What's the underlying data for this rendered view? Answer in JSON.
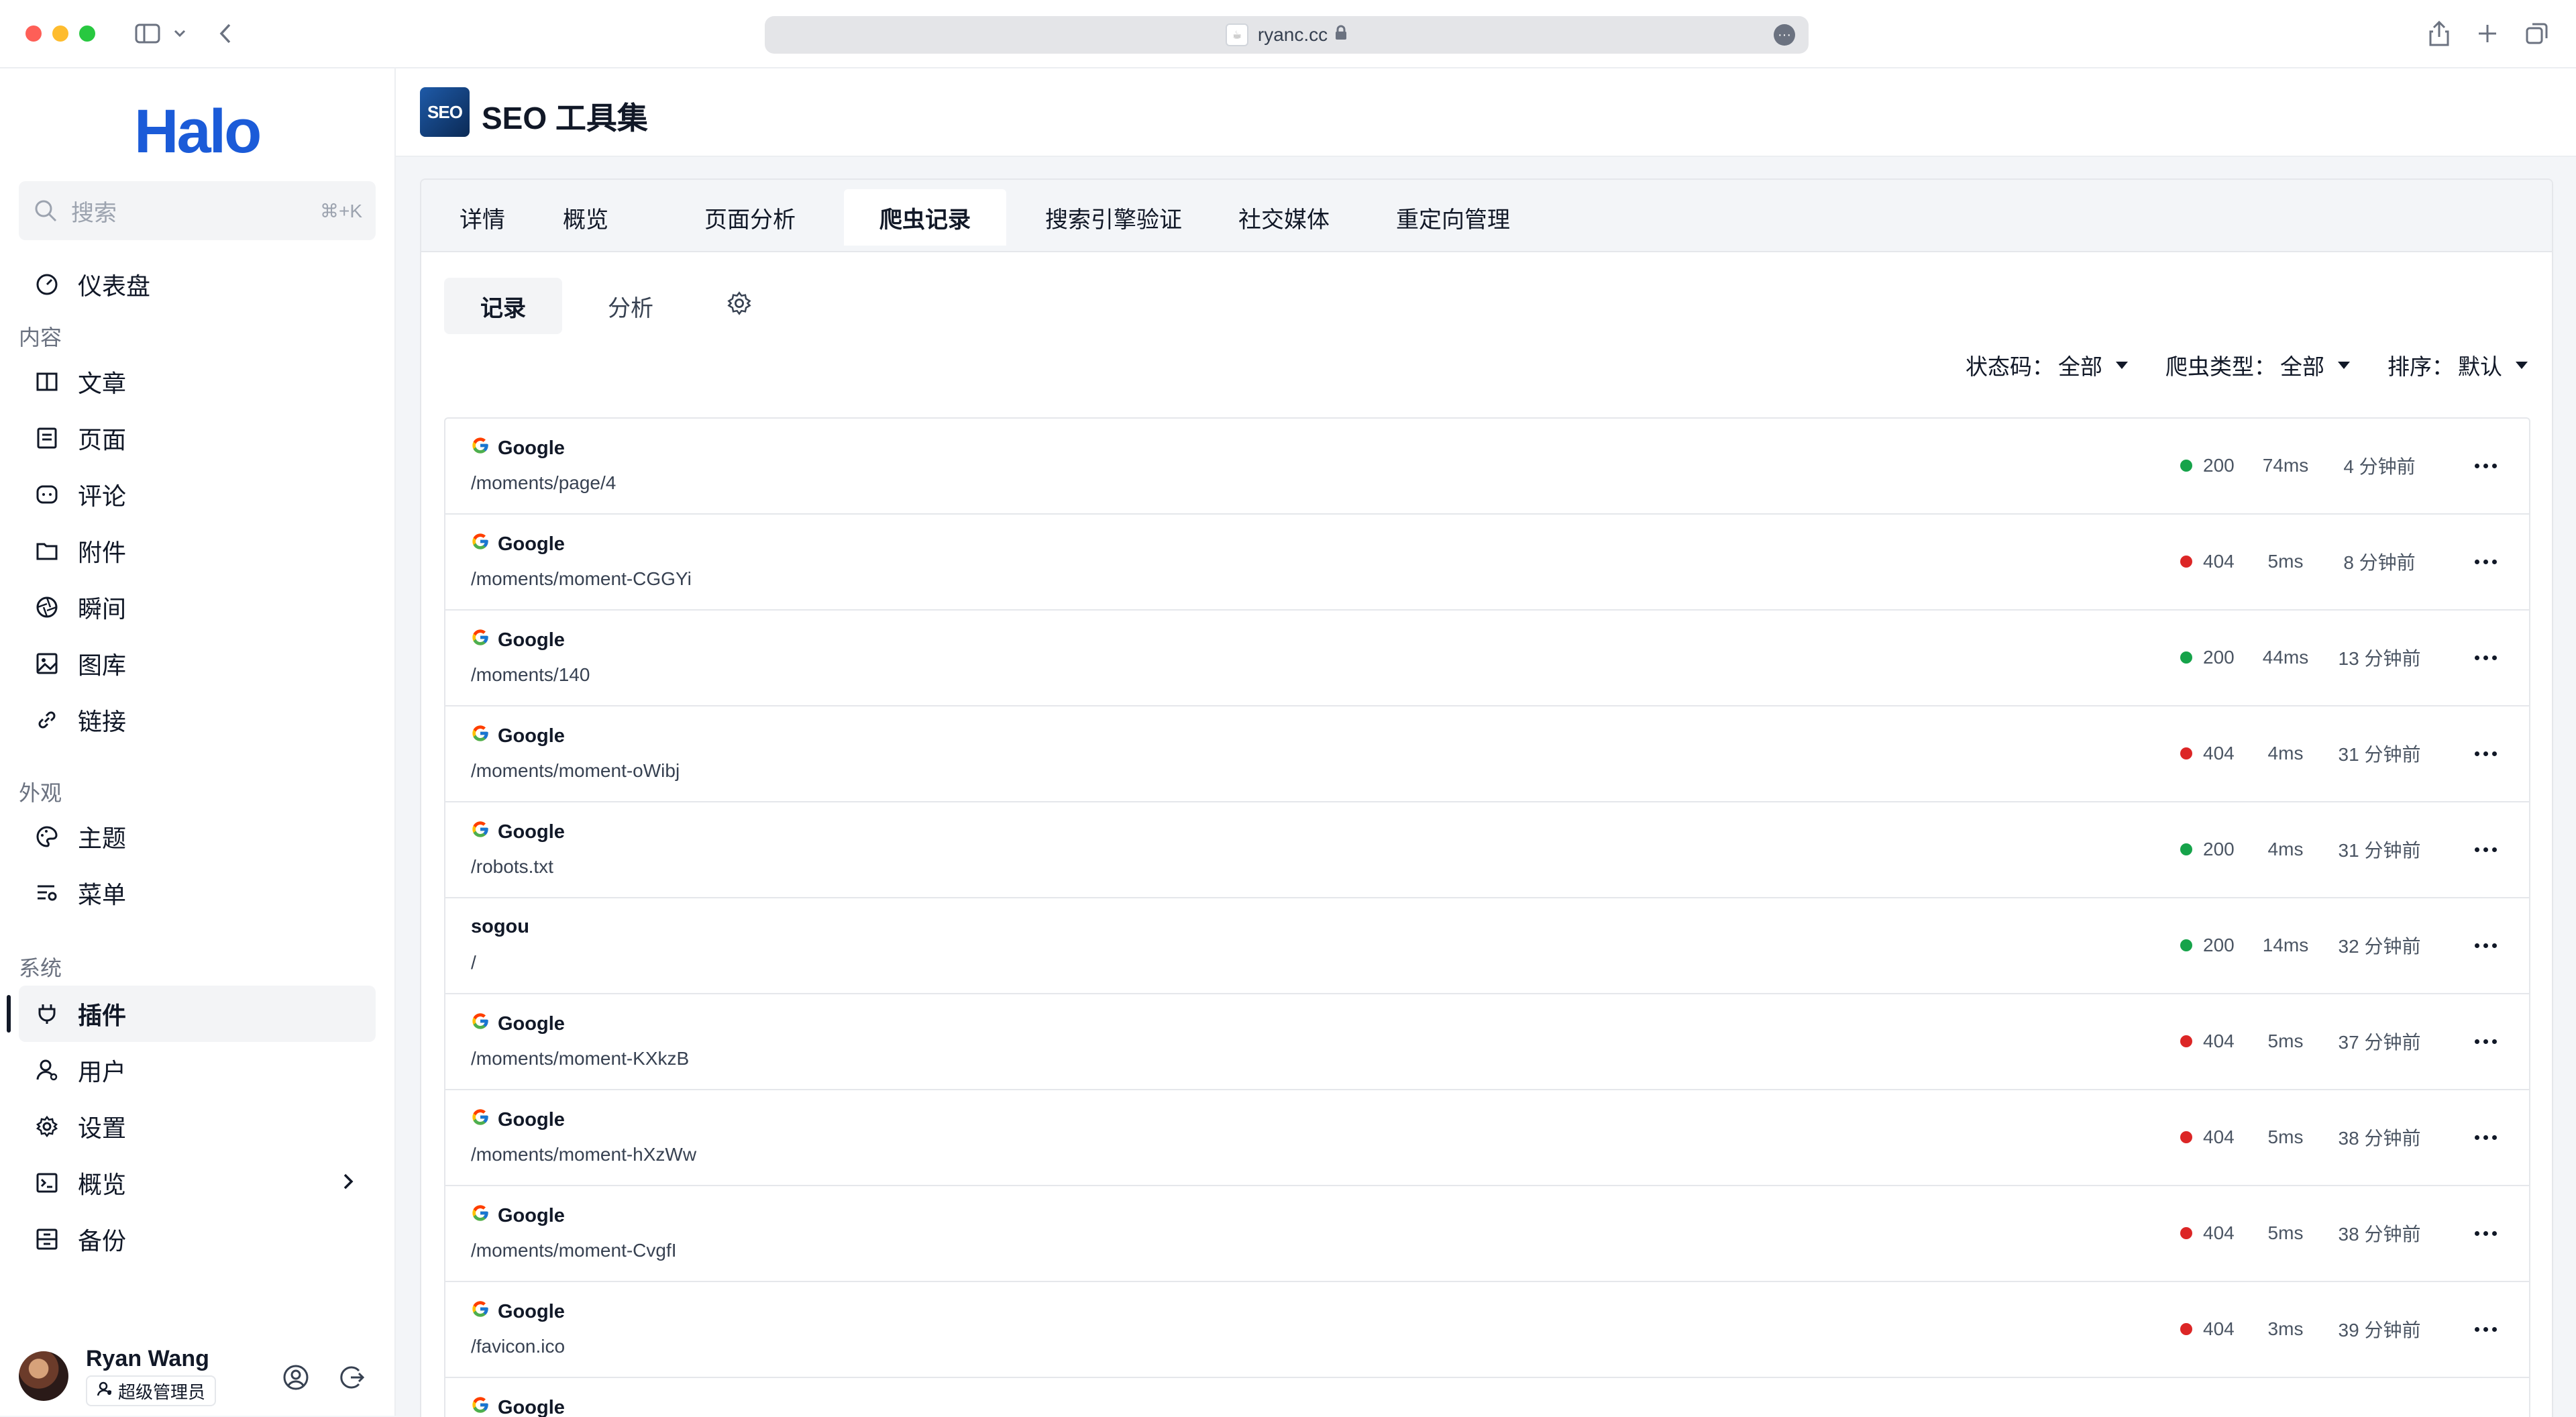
{
  "browser": {
    "url": "ryanc.cc"
  },
  "sidebar": {
    "logo": "Halo",
    "search": {
      "placeholder": "搜索",
      "shortcut": "⌘+K"
    },
    "dashboard": "仪表盘",
    "sections": [
      {
        "title": "内容",
        "items": [
          "文章",
          "页面",
          "评论",
          "附件",
          "瞬间",
          "图库",
          "链接"
        ]
      },
      {
        "title": "外观",
        "items": [
          "主题",
          "菜单"
        ]
      },
      {
        "title": "系统",
        "items": [
          "插件",
          "用户",
          "设置",
          "概览",
          "备份"
        ]
      }
    ],
    "active_item": "插件",
    "user": {
      "name": "Ryan Wang",
      "role": "超级管理员"
    }
  },
  "header": {
    "logo_text": "SEO",
    "title": "SEO 工具集"
  },
  "tabs": [
    "详情",
    "概览",
    "页面分析",
    "爬虫记录",
    "搜索引擎验证",
    "社交媒体",
    "重定向管理"
  ],
  "active_tab": "爬虫记录",
  "subtabs": [
    "记录",
    "分析"
  ],
  "filters": [
    {
      "label": "状态码：",
      "value": "全部"
    },
    {
      "label": "爬虫类型：",
      "value": "全部"
    },
    {
      "label": "排序：",
      "value": "默认"
    }
  ],
  "records": [
    {
      "bot": "Google",
      "path": "/moments/page/4",
      "status": "200",
      "duration": "74ms",
      "ago": "4 分钟前"
    },
    {
      "bot": "Google",
      "path": "/moments/moment-CGGYi",
      "status": "404",
      "duration": "5ms",
      "ago": "8 分钟前"
    },
    {
      "bot": "Google",
      "path": "/moments/140",
      "status": "200",
      "duration": "44ms",
      "ago": "13 分钟前"
    },
    {
      "bot": "Google",
      "path": "/moments/moment-oWibj",
      "status": "404",
      "duration": "4ms",
      "ago": "31 分钟前"
    },
    {
      "bot": "Google",
      "path": "/robots.txt",
      "status": "200",
      "duration": "4ms",
      "ago": "31 分钟前"
    },
    {
      "bot": "sogou",
      "path": "/",
      "status": "200",
      "duration": "14ms",
      "ago": "32 分钟前"
    },
    {
      "bot": "Google",
      "path": "/moments/moment-KXkzB",
      "status": "404",
      "duration": "5ms",
      "ago": "37 分钟前"
    },
    {
      "bot": "Google",
      "path": "/moments/moment-hXzWw",
      "status": "404",
      "duration": "5ms",
      "ago": "38 分钟前"
    },
    {
      "bot": "Google",
      "path": "/moments/moment-CvgfI",
      "status": "404",
      "duration": "5ms",
      "ago": "38 分钟前"
    },
    {
      "bot": "Google",
      "path": "/favicon.ico",
      "status": "404",
      "duration": "3ms",
      "ago": "39 分钟前"
    },
    {
      "bot": "Google",
      "path": "",
      "status": "",
      "duration": "",
      "ago": ""
    }
  ],
  "colors": {
    "brand": "#1b5bd8",
    "ok": "#16a34a",
    "error": "#dc2626"
  }
}
